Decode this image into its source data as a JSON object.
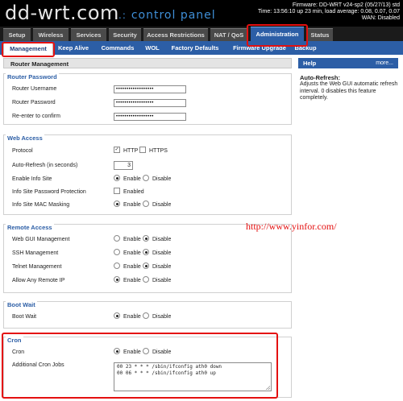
{
  "header": {
    "logo": "dd-wrt.com",
    "subtitle": "control panel",
    "status": {
      "firmware": "Firmware: DD-WRT v24-sp2 (05/27/13) std",
      "time": "Time: 13:56:10 up 23 min, load average: 0.08, 0.07, 0.07",
      "wan": "WAN: Disabled"
    }
  },
  "main_tabs": [
    "Setup",
    "Wireless",
    "Services",
    "Security",
    "Access Restrictions",
    "NAT / QoS",
    "Administration",
    "Status"
  ],
  "sub_tabs": [
    "Management",
    "Keep Alive",
    "Commands",
    "WOL",
    "Factory Defaults",
    "Firmware Upgrade",
    "Backup"
  ],
  "page_title": "Router Management",
  "router_password": {
    "legend": "Router Password",
    "username_label": "Router Username",
    "username_value": "••••••••••••••••••",
    "password_label": "Router Password",
    "password_value": "••••••••••••••••••",
    "confirm_label": "Re-enter to confirm",
    "confirm_value": "••••••••••••••••••"
  },
  "web_access": {
    "legend": "Web Access",
    "protocol_label": "Protocol",
    "http_label": "HTTP",
    "http_checked": true,
    "https_label": "HTTPS",
    "https_checked": false,
    "autorefresh_label": "Auto-Refresh (in seconds)",
    "autorefresh_value": "3",
    "info_site_label": "Enable Info Site",
    "info_password_label": "Info Site Password Protection",
    "info_password_option": "Enabled",
    "info_mac_label": "Info Site MAC Masking"
  },
  "remote_access": {
    "legend": "Remote Access",
    "gui_label": "Web GUI Management",
    "ssh_label": "SSH Management",
    "telnet_label": "Telnet Management",
    "anyip_label": "Allow Any Remote IP"
  },
  "boot_wait": {
    "legend": "Boot Wait",
    "label": "Boot Wait"
  },
  "cron": {
    "legend": "Cron",
    "label": "Cron",
    "jobs_label": "Additional Cron Jobs",
    "jobs_value": "00 23 * * * /sbin/ifconfig ath0 down\n00 06 * * * /sbin/ifconfig ath0 up"
  },
  "options": {
    "enable": "Enable",
    "disable": "Disable"
  },
  "help": {
    "title": "Help",
    "more": "more...",
    "heading": "Auto-Refresh:",
    "text": "Adjusts the Web GUI automatic refresh interval. 0 disables this feature completely."
  },
  "annotation_url": "http://www.yinfor.com/",
  "colors": {
    "accent": "#2c5ea6",
    "highlight": "#e41010",
    "header": "#000000"
  }
}
